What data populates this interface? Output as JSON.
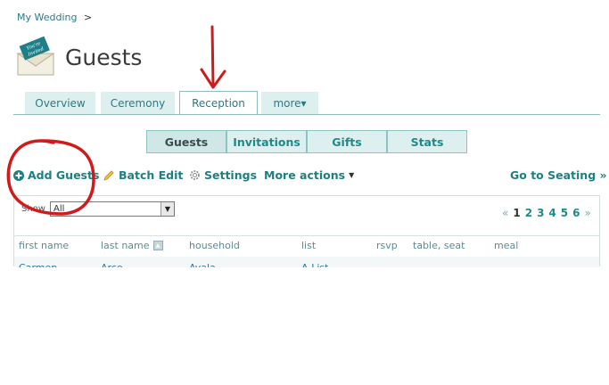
{
  "breadcrumb": {
    "link": "My Wedding",
    "separator": ">"
  },
  "header": {
    "title": "Guests",
    "logo_text": "You're Invited"
  },
  "tabs": [
    {
      "label": "Overview"
    },
    {
      "label": "Ceremony"
    },
    {
      "label": "Reception"
    },
    {
      "label": "more▾"
    }
  ],
  "subtabs": [
    {
      "label": "Guests"
    },
    {
      "label": "Invitations"
    },
    {
      "label": "Gifts"
    },
    {
      "label": "Stats"
    }
  ],
  "actions": {
    "add_guests": "Add Guests",
    "batch_edit": "Batch Edit",
    "settings": "Settings",
    "more_actions": "More actions",
    "go_to_seating": "Go to Seating »"
  },
  "filter": {
    "label": "Show",
    "value": "All"
  },
  "pager": {
    "prev": "«",
    "pages": [
      "1",
      "2",
      "3",
      "4",
      "5",
      "6"
    ],
    "next": "»",
    "current": "1"
  },
  "columns": [
    "first name",
    "last name",
    "household",
    "list",
    "rsvp",
    "table, seat",
    "meal"
  ],
  "rows": [
    {
      "first": "Carmen",
      "last": "Arce",
      "household": "Ayala",
      "list": "A-List"
    }
  ],
  "colors": {
    "accent": "#1e7f82",
    "tab_bg": "#ddf0ef",
    "annotation": "#d11a1a"
  }
}
